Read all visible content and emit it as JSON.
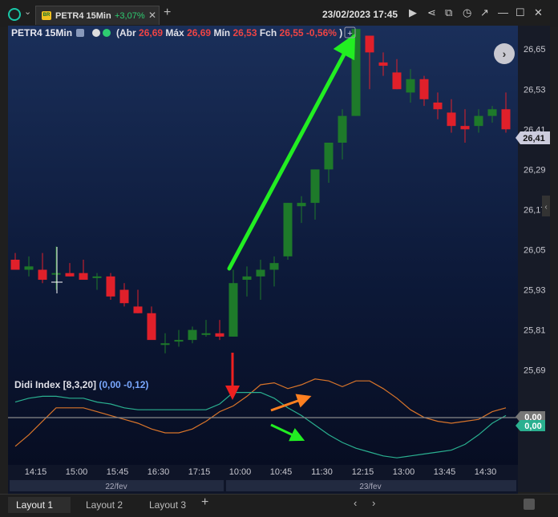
{
  "header": {
    "tab_symbol": "PETR4 15Min",
    "tab_change": "+3,07%",
    "tab_flag": "BR",
    "datetime": "23/02/2023 17:45"
  },
  "legend": {
    "symbol": "PETR4 15Min",
    "abr_label": "(Abr",
    "abr": "26,69",
    "max_label": "Máx",
    "max": "26,69",
    "min_label": "Mín",
    "min": "26,53",
    "fch_label": "Fch",
    "fch": "26,55",
    "pct": "-0,56%",
    "close_paren": ")"
  },
  "indicator": {
    "name": "Didi Index [8,3,20]",
    "v1": "(0,00",
    "v2": "-0,12)",
    "tag1": "0,00",
    "tag2": "0,00"
  },
  "price_tag": "26,41",
  "bottom": {
    "tabs": [
      "Layout 1",
      "Layout 2",
      "Layout 3"
    ]
  },
  "colors": {
    "up": "#1e7a2a",
    "down": "#e0202a",
    "annotation_green": "#22ee22",
    "annotation_red": "#ee2020",
    "annotation_orange": "#ff8020",
    "didi_orange": "#d8742a",
    "didi_teal": "#2ab090"
  },
  "chart_data": [
    {
      "type": "candlestick",
      "title": "PETR4 15Min",
      "y_ticks": [
        "26,65",
        "26,53",
        "26,41",
        "26,29",
        "26,17",
        "26,05",
        "25,93",
        "25,81",
        "25,69"
      ],
      "y_tick_values": [
        26.65,
        26.53,
        26.41,
        26.29,
        26.17,
        26.05,
        25.93,
        25.81,
        25.69
      ],
      "ylim": [
        25.67,
        26.72
      ],
      "x_ticks": [
        "14:15",
        "15:00",
        "15:45",
        "16:30",
        "17:15",
        "10:00",
        "10:45",
        "11:30",
        "12:15",
        "13:00",
        "13:45",
        "14:30"
      ],
      "x_tick_index": [
        1.5,
        4.5,
        7.5,
        10.5,
        13.5,
        16.5,
        19.5,
        22.5,
        25.5,
        28.5,
        31.5,
        34.5
      ],
      "dates": [
        "22/fev",
        "23/fev"
      ],
      "candles": [
        {
          "o": 26.02,
          "h": 26.04,
          "l": 25.99,
          "c": 25.99
        },
        {
          "o": 25.99,
          "h": 26.03,
          "l": 25.97,
          "c": 26.0
        },
        {
          "o": 25.99,
          "h": 26.04,
          "l": 25.95,
          "c": 25.96
        },
        {
          "o": 25.98,
          "h": 26.06,
          "l": 25.93,
          "c": 25.98
        },
        {
          "o": 25.98,
          "h": 26.01,
          "l": 25.97,
          "c": 25.97
        },
        {
          "o": 25.98,
          "h": 26.02,
          "l": 25.96,
          "c": 25.96
        },
        {
          "o": 25.97,
          "h": 25.98,
          "l": 25.93,
          "c": 25.97
        },
        {
          "o": 25.97,
          "h": 25.98,
          "l": 25.9,
          "c": 25.91
        },
        {
          "o": 25.93,
          "h": 25.95,
          "l": 25.88,
          "c": 25.89
        },
        {
          "o": 25.88,
          "h": 25.93,
          "l": 25.86,
          "c": 25.86
        },
        {
          "o": 25.86,
          "h": 25.88,
          "l": 25.79,
          "c": 25.78
        },
        {
          "o": 25.77,
          "h": 25.8,
          "l": 25.74,
          "c": 25.77
        },
        {
          "o": 25.78,
          "h": 25.81,
          "l": 25.76,
          "c": 25.78
        },
        {
          "o": 25.78,
          "h": 25.82,
          "l": 25.77,
          "c": 25.81
        },
        {
          "o": 25.8,
          "h": 25.84,
          "l": 25.79,
          "c": 25.8
        },
        {
          "o": 25.8,
          "h": 25.84,
          "l": 25.78,
          "c": 25.79
        },
        {
          "o": 25.79,
          "h": 25.99,
          "l": 25.79,
          "c": 25.95
        },
        {
          "o": 25.96,
          "h": 26.0,
          "l": 25.91,
          "c": 25.97
        },
        {
          "o": 25.97,
          "h": 26.02,
          "l": 25.9,
          "c": 25.99
        },
        {
          "o": 25.99,
          "h": 26.03,
          "l": 25.94,
          "c": 26.01
        },
        {
          "o": 26.03,
          "h": 26.19,
          "l": 26.02,
          "c": 26.19
        },
        {
          "o": 26.18,
          "h": 26.21,
          "l": 26.13,
          "c": 26.19
        },
        {
          "o": 26.19,
          "h": 26.29,
          "l": 26.14,
          "c": 26.29
        },
        {
          "o": 26.29,
          "h": 26.37,
          "l": 26.25,
          "c": 26.37
        },
        {
          "o": 26.37,
          "h": 26.47,
          "l": 26.32,
          "c": 26.45
        },
        {
          "o": 26.45,
          "h": 26.71,
          "l": 26.45,
          "c": 26.71
        },
        {
          "o": 26.69,
          "h": 26.69,
          "l": 26.53,
          "c": 26.64
        },
        {
          "o": 26.61,
          "h": 26.64,
          "l": 26.57,
          "c": 26.6
        },
        {
          "o": 26.58,
          "h": 26.62,
          "l": 26.53,
          "c": 26.53
        },
        {
          "o": 26.52,
          "h": 26.59,
          "l": 26.49,
          "c": 26.56
        },
        {
          "o": 26.56,
          "h": 26.57,
          "l": 26.48,
          "c": 26.5
        },
        {
          "o": 26.49,
          "h": 26.52,
          "l": 26.44,
          "c": 26.47
        },
        {
          "o": 26.46,
          "h": 26.5,
          "l": 26.4,
          "c": 26.42
        },
        {
          "o": 26.42,
          "h": 26.47,
          "l": 26.37,
          "c": 26.41
        },
        {
          "o": 26.42,
          "h": 26.47,
          "l": 26.4,
          "c": 26.45
        },
        {
          "o": 26.45,
          "h": 26.48,
          "l": 26.43,
          "c": 26.47
        },
        {
          "o": 26.47,
          "h": 26.52,
          "l": 26.4,
          "c": 26.41
        }
      ]
    },
    {
      "type": "line",
      "title": "Didi Index [8,3,20]",
      "ylim": [
        -0.28,
        0.22
      ],
      "series": [
        {
          "values": [
            -0.2,
            -0.14,
            -0.07,
            0.0,
            0.0,
            0.0,
            -0.02,
            -0.04,
            -0.06,
            -0.08,
            -0.11,
            -0.13,
            -0.13,
            -0.11,
            -0.07,
            -0.02,
            0.01,
            0.06,
            0.12,
            0.13,
            0.1,
            0.12,
            0.15,
            0.14,
            0.11,
            0.14,
            0.14,
            0.1,
            0.05,
            -0.01,
            -0.05,
            -0.07,
            -0.08,
            -0.07,
            -0.06,
            -0.02,
            0.0
          ]
        },
        {
          "values": [
            0.03,
            0.05,
            0.06,
            0.06,
            0.05,
            0.05,
            0.03,
            0.02,
            0.0,
            -0.01,
            -0.01,
            -0.01,
            -0.01,
            -0.01,
            -0.01,
            0.02,
            0.08,
            0.08,
            0.08,
            0.05,
            0.0,
            -0.04,
            -0.09,
            -0.14,
            -0.18,
            -0.21,
            -0.23,
            -0.25,
            -0.26,
            -0.25,
            -0.24,
            -0.23,
            -0.22,
            -0.19,
            -0.14,
            -0.08,
            -0.04
          ]
        }
      ]
    }
  ]
}
